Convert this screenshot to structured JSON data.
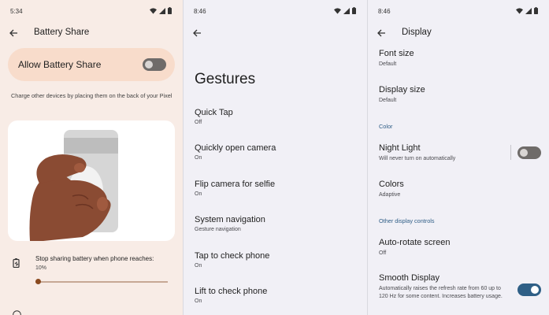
{
  "battery_share": {
    "status_time": "5:34",
    "title": "Battery Share",
    "allow_label": "Allow Battery Share",
    "allow_enabled": false,
    "charge_hint": "Charge other devices by placing them on the back of your Pixel",
    "stop_label": "Stop sharing battery when phone reaches:",
    "stop_value": "10%",
    "slider_fraction": 0.0
  },
  "gestures": {
    "status_time": "8:46",
    "title": "Gestures",
    "items": [
      {
        "title": "Quick Tap",
        "subtitle": "Off"
      },
      {
        "title": "Quickly open camera",
        "subtitle": "On"
      },
      {
        "title": "Flip camera for selfie",
        "subtitle": "On"
      },
      {
        "title": "System navigation",
        "subtitle": "Gesture navigation"
      },
      {
        "title": "Tap to check phone",
        "subtitle": "On"
      },
      {
        "title": "Lift to check phone",
        "subtitle": "On"
      }
    ]
  },
  "display": {
    "status_time": "8:46",
    "title": "Display",
    "font_size": {
      "title": "Font size",
      "subtitle": "Default"
    },
    "display_size": {
      "title": "Display size",
      "subtitle": "Default"
    },
    "section_color": "Color",
    "night_light": {
      "title": "Night Light",
      "subtitle": "Will never turn on automatically",
      "enabled": false
    },
    "colors": {
      "title": "Colors",
      "subtitle": "Adaptive"
    },
    "section_other": "Other display controls",
    "auto_rotate": {
      "title": "Auto-rotate screen",
      "subtitle": "Off"
    },
    "smooth_display": {
      "title": "Smooth Display",
      "subtitle": "Automatically raises the refresh rate from 60 up to 120 Hz for some content. Increases battery usage.",
      "enabled": true
    }
  },
  "icons": [
    "back-arrow-icon",
    "wifi-icon",
    "cellular-signal-icon",
    "battery-icon",
    "battery-share-icon",
    "info-icon"
  ],
  "colors": {
    "accent_peach": "#f8dccb",
    "accent_blue": "#2f5f86",
    "section_label": "#2e5d86"
  }
}
